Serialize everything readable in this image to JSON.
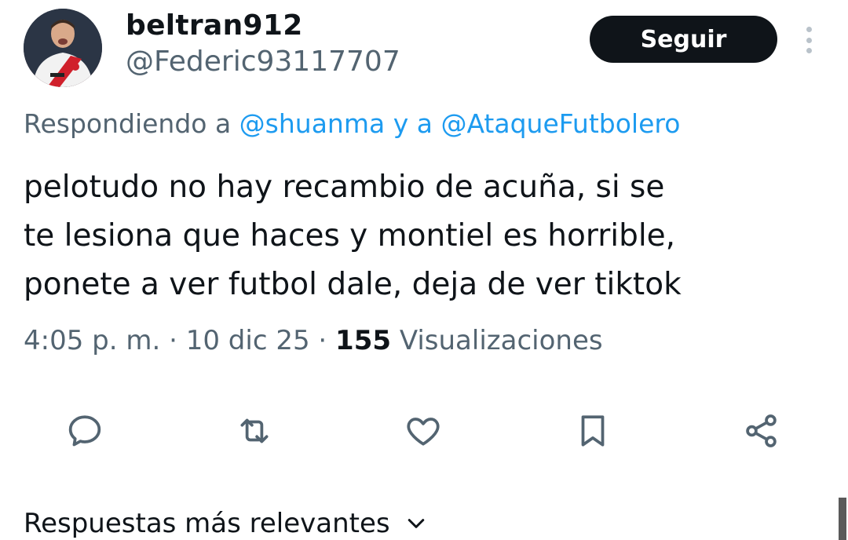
{
  "user": {
    "display_name": "beltran912",
    "handle": "@Federic93117707",
    "avatar": "player-photo"
  },
  "follow_label": "Seguir",
  "reply": {
    "prefix": "Respondiendo a ",
    "mention1": "@shuanma",
    "connector": " y a ",
    "mention2": "@AtaqueFutbolero"
  },
  "tweet": {
    "lines": [
      "pelotudo no hay recambio de acuña, si se",
      "te lesiona que haces y montiel es horrible,",
      "ponete a ver futbol dale, deja de ver tiktok"
    ]
  },
  "meta": {
    "time": "4:05 p. m.",
    "sep1": " · ",
    "date": "10 dic 25",
    "sep2": " · ",
    "views_count": "155",
    "views_label": " Visualizaciones"
  },
  "actions": [
    "reply-icon",
    "retweet-icon",
    "like-icon",
    "bookmark-icon",
    "share-icon"
  ],
  "replies_section": {
    "title": "Respuestas más relevantes"
  },
  "colors": {
    "text": "#0f1419",
    "secondary": "#536471",
    "link": "#1d9bf0",
    "button_bg": "#0f1419"
  }
}
